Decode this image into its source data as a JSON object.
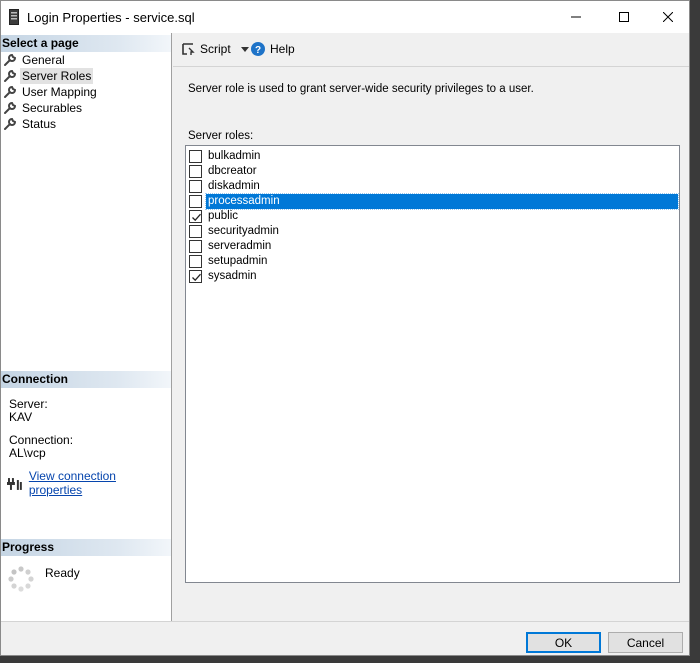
{
  "window": {
    "title": "Login Properties - service.sql"
  },
  "left_panel": {
    "select_page_header": "Select a page",
    "nav_items": [
      {
        "label": "General",
        "selected": false
      },
      {
        "label": "Server Roles",
        "selected": true
      },
      {
        "label": "User Mapping",
        "selected": false
      },
      {
        "label": "Securables",
        "selected": false
      },
      {
        "label": "Status",
        "selected": false
      }
    ],
    "connection_header": "Connection",
    "server_label": "Server:",
    "server_value": "KAV",
    "connection_label": "Connection:",
    "connection_value": "AL\\vcp",
    "view_connection_link": "View connection properties",
    "progress_header": "Progress",
    "progress_status": "Ready"
  },
  "toolbar": {
    "script_label": "Script",
    "help_label": "Help"
  },
  "content": {
    "description": "Server role is used to grant server-wide security privileges to a user.",
    "roles_label": "Server roles:",
    "roles": [
      {
        "name": "bulkadmin",
        "checked": false,
        "selected": false
      },
      {
        "name": "dbcreator",
        "checked": false,
        "selected": false
      },
      {
        "name": "diskadmin",
        "checked": false,
        "selected": false
      },
      {
        "name": "processadmin",
        "checked": false,
        "selected": true
      },
      {
        "name": "public",
        "checked": true,
        "selected": false
      },
      {
        "name": "securityadmin",
        "checked": false,
        "selected": false
      },
      {
        "name": "serveradmin",
        "checked": false,
        "selected": false
      },
      {
        "name": "setupadmin",
        "checked": false,
        "selected": false
      },
      {
        "name": "sysadmin",
        "checked": true,
        "selected": false
      }
    ]
  },
  "buttons": {
    "ok_label": "OK",
    "cancel_label": "Cancel"
  },
  "colors": {
    "selection": "#0078d7",
    "link": "#0645ad",
    "help_icon": "#1e73c8"
  }
}
